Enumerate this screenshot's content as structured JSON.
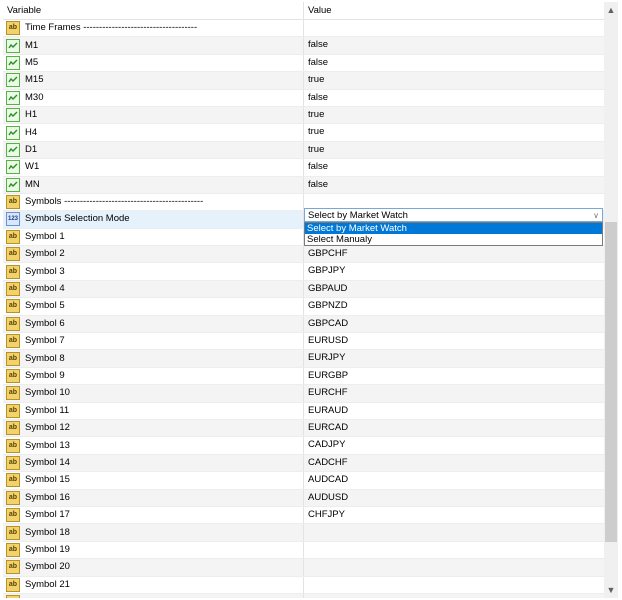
{
  "header": {
    "variable": "Variable",
    "value": "Value"
  },
  "rows": [
    {
      "icon": "ab-icon",
      "name": "Time Frames ------------------------------------",
      "value": ""
    },
    {
      "icon": "timeframe-icon",
      "name": "M1",
      "value": "false"
    },
    {
      "icon": "timeframe-icon",
      "name": "M5",
      "value": "false"
    },
    {
      "icon": "timeframe-icon",
      "name": "M15",
      "value": "true"
    },
    {
      "icon": "timeframe-icon",
      "name": "M30",
      "value": "false"
    },
    {
      "icon": "timeframe-icon",
      "name": "H1",
      "value": "true"
    },
    {
      "icon": "timeframe-icon",
      "name": "H4",
      "value": "true"
    },
    {
      "icon": "timeframe-icon",
      "name": "D1",
      "value": "true"
    },
    {
      "icon": "timeframe-icon",
      "name": "W1",
      "value": "false"
    },
    {
      "icon": "timeframe-icon",
      "name": "MN",
      "value": "false"
    },
    {
      "icon": "ab-icon",
      "name": "Symbols --------------------------------------------",
      "value": ""
    },
    {
      "icon": "enum-icon",
      "name": "Symbols Selection Mode",
      "value": ""
    },
    {
      "icon": "ab-icon",
      "name": "Symbol 1",
      "value": ""
    },
    {
      "icon": "ab-icon",
      "name": "Symbol 2",
      "value": "GBPCHF"
    },
    {
      "icon": "ab-icon",
      "name": "Symbol 3",
      "value": "GBPJPY"
    },
    {
      "icon": "ab-icon",
      "name": "Symbol 4",
      "value": "GBPAUD"
    },
    {
      "icon": "ab-icon",
      "name": "Symbol 5",
      "value": "GBPNZD"
    },
    {
      "icon": "ab-icon",
      "name": "Symbol 6",
      "value": "GBPCAD"
    },
    {
      "icon": "ab-icon",
      "name": "Symbol 7",
      "value": "EURUSD"
    },
    {
      "icon": "ab-icon",
      "name": "Symbol 8",
      "value": "EURJPY"
    },
    {
      "icon": "ab-icon",
      "name": "Symbol 9",
      "value": "EURGBP"
    },
    {
      "icon": "ab-icon",
      "name": "Symbol 10",
      "value": "EURCHF"
    },
    {
      "icon": "ab-icon",
      "name": "Symbol 11",
      "value": "EURAUD"
    },
    {
      "icon": "ab-icon",
      "name": "Symbol 12",
      "value": "EURCAD"
    },
    {
      "icon": "ab-icon",
      "name": "Symbol 13",
      "value": "CADJPY"
    },
    {
      "icon": "ab-icon",
      "name": "Symbol 14",
      "value": "CADCHF"
    },
    {
      "icon": "ab-icon",
      "name": "Symbol 15",
      "value": "AUDCAD"
    },
    {
      "icon": "ab-icon",
      "name": "Symbol 16",
      "value": "AUDUSD"
    },
    {
      "icon": "ab-icon",
      "name": "Symbol 17",
      "value": "CHFJPY"
    },
    {
      "icon": "ab-icon",
      "name": "Symbol 18",
      "value": ""
    },
    {
      "icon": "ab-icon",
      "name": "Symbol 19",
      "value": ""
    },
    {
      "icon": "ab-icon",
      "name": "Symbol 20",
      "value": ""
    },
    {
      "icon": "ab-icon",
      "name": "Symbol 21",
      "value": ""
    },
    {
      "icon": "ab-icon",
      "name": "",
      "value": ""
    }
  ],
  "selection_mode": {
    "selected": "Select by Market Watch",
    "options": [
      "Select by Market Watch",
      "Select Manualy"
    ],
    "arrow_icon": "chevron-down-icon"
  },
  "scrollbar": {
    "up_icon": "scroll-up-icon",
    "down_icon": "scroll-down-icon"
  },
  "colors": {
    "selection": "#0078d7",
    "selected_row": "#e5f1fb",
    "string_icon": "#f2d36b",
    "timeframe_icon": "#58b046"
  }
}
